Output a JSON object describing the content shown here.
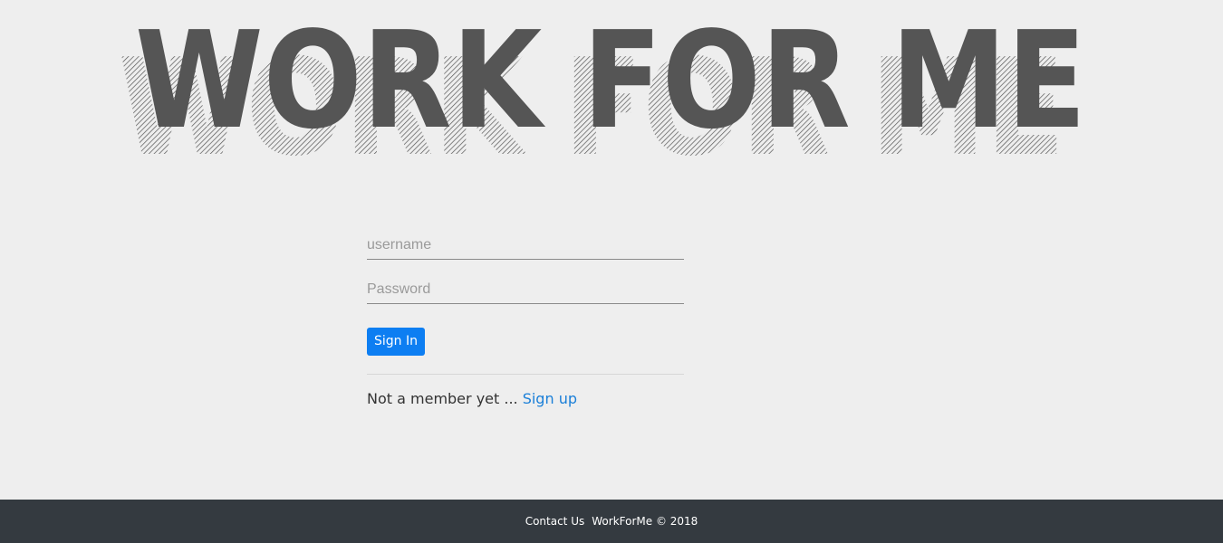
{
  "logo": {
    "text": "WORK FOR ME"
  },
  "form": {
    "username_placeholder": "username",
    "password_placeholder": "Password",
    "signin_label": "Sign In",
    "member_prompt": "Not a member yet ... ",
    "signup_link": "Sign up"
  },
  "footer": {
    "contact_link": "Contact Us",
    "copyright": "WorkForMe © 2018"
  },
  "colors": {
    "background": "#eeeeee",
    "logo_fill": "#555555",
    "primary_button": "#0d7ef2",
    "link": "#1a7fd8",
    "footer_bg": "#343a40"
  }
}
